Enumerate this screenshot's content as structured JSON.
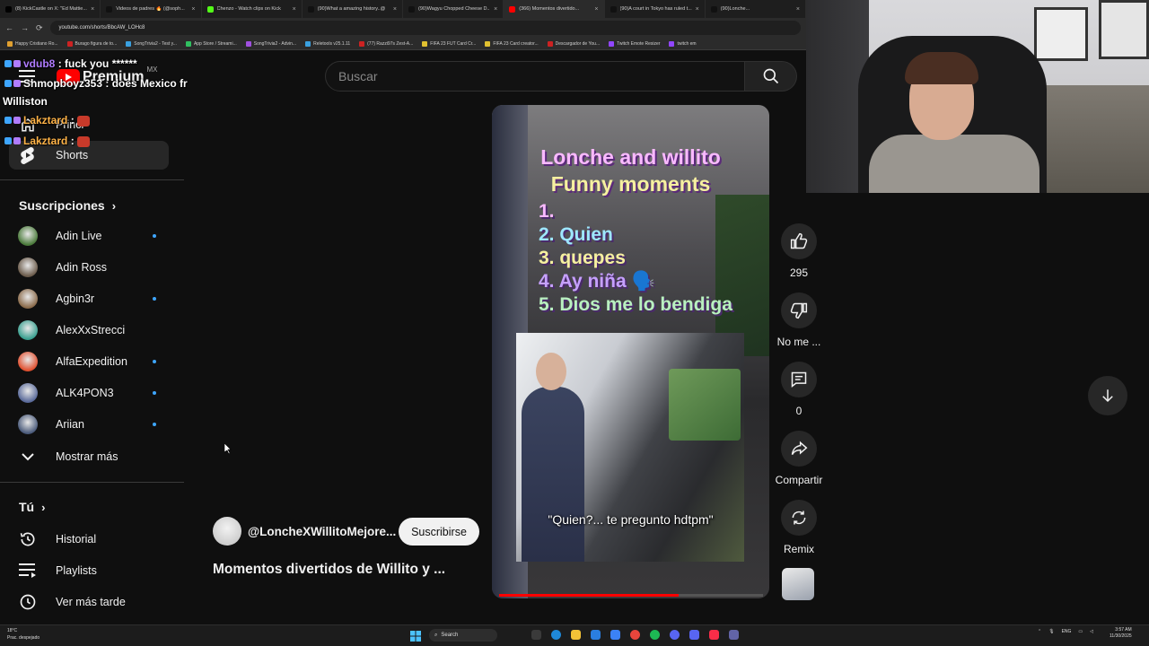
{
  "browser": {
    "tabs": [
      {
        "label": "(8) KickCastle on X: \"Ed Mattie...",
        "color": "#000000",
        "active": false
      },
      {
        "label": "Videos de padres 🔥 (@soph...",
        "color": "#111111",
        "active": false
      },
      {
        "label": "Chenzo - Watch clips on Kick",
        "color": "#53fc18",
        "active": false
      },
      {
        "label": "(90)What a amazing history..@",
        "color": "#111111",
        "active": false
      },
      {
        "label": "(90)Wagyu Chopped Cheese D...",
        "color": "#111111",
        "active": false
      },
      {
        "label": "(366) Momentos divertido...",
        "color": "#ff0000",
        "active": true
      },
      {
        "label": "(90)A court in Tokyo has ruled t...",
        "color": "#111111",
        "active": false
      },
      {
        "label": "(90)Lonche...",
        "color": "#111111",
        "active": false
      }
    ],
    "url": "youtube.com/shorts/BbcAW_LOHc8",
    "bookmarks": [
      {
        "label": "Happy Cristiano Ro...",
        "color": "#e0a030"
      },
      {
        "label": "Burago figura de to...",
        "color": "#cc2222"
      },
      {
        "label": "SongTrivia2 - Test y...",
        "color": "#3aa0e0"
      },
      {
        "label": "App Store / Streami...",
        "color": "#30c060"
      },
      {
        "label": "SongTrivia2 - Advin...",
        "color": "#a050e0"
      },
      {
        "label": "Reletools v25.1.11",
        "color": "#3aa0e0"
      },
      {
        "label": "(77) Razzi97s Zest-A...",
        "color": "#cc2222"
      },
      {
        "label": "FIFA 23 FUT Card Cr...",
        "color": "#e0c030"
      },
      {
        "label": "FIFA 23 Card creator...",
        "color": "#e0c030"
      },
      {
        "label": "Descargador de You...",
        "color": "#cc2222"
      },
      {
        "label": "Twitch Emote Resizer",
        "color": "#9146ff"
      },
      {
        "label": "twitch em",
        "color": "#9146ff"
      }
    ]
  },
  "search": {
    "placeholder": "Buscar"
  },
  "logo": {
    "premium": "Premium",
    "country": "MX"
  },
  "sidebar": {
    "partial_item": "Princi",
    "shorts_label": "Shorts",
    "subscriptions_header": "Suscripciones",
    "channels": [
      {
        "name": "Adin Live",
        "new": true,
        "color": "#4a7a3a"
      },
      {
        "name": "Adin Ross",
        "new": false,
        "color": "#6a5a4a"
      },
      {
        "name": "Agbin3r",
        "new": true,
        "color": "#8a6a4a"
      },
      {
        "name": "AlexXxStrecci",
        "new": false,
        "color": "#3aa090"
      },
      {
        "name": "AlfaExpedition",
        "new": true,
        "color": "#e05030"
      },
      {
        "name": "ALK4PON3",
        "new": true,
        "color": "#5a6a9a"
      },
      {
        "name": "Ariian",
        "new": true,
        "color": "#4a5a7a"
      }
    ],
    "show_more": "Mostrar más",
    "you_header": "Tú",
    "you_items": [
      {
        "label": "Historial",
        "icon": "history-icon"
      },
      {
        "label": "Playlists",
        "icon": "playlists-icon"
      },
      {
        "label": "Ver más tarde",
        "icon": "watch-later-icon"
      }
    ]
  },
  "chat": [
    {
      "user": "vdub8",
      "msg": ": fuck you ******",
      "color": "#b07cff"
    },
    {
      "user": "Shmopboyz353",
      "msg": ": does Mexico fr",
      "color": "#ffffff"
    },
    {
      "user": "",
      "msg": "Williston",
      "color": "#ffffff"
    },
    {
      "user": "Lakztard",
      "msg": ":",
      "color": "#ffb347"
    },
    {
      "user": "Lakztard",
      "msg": ":",
      "color": "#ffb347"
    }
  ],
  "video": {
    "overlay_title_1": "Lonche and willito",
    "overlay_title_2": "Funny moments",
    "list": [
      "1.",
      "2. Quien",
      "3. quepes",
      "4. Ay niña 🗣️",
      "5. Dios me lo bendiga"
    ],
    "caption": "\"Quien?... te pregunto hdtpm\"",
    "progress": 0.68,
    "channel_handle": "@LoncheXWillitoMejore...",
    "subscribe_label": "Suscribirse",
    "title": "Momentos divertidos de Willito y ..."
  },
  "actions": {
    "likes": "295",
    "dislike_label": "No me ...",
    "comments": "0",
    "share_label": "Compartir",
    "remix_label": "Remix"
  },
  "taskbar": {
    "weather_temp": "18°C",
    "weather_desc": "Prac. despejado",
    "search_label": "Search",
    "lang": "ENG",
    "time": "3:57 AM",
    "date": "11/30/2025"
  },
  "colors": {
    "accent": "#3ea6ff",
    "progress": "#ff0000",
    "background": "#0f0f0f"
  }
}
